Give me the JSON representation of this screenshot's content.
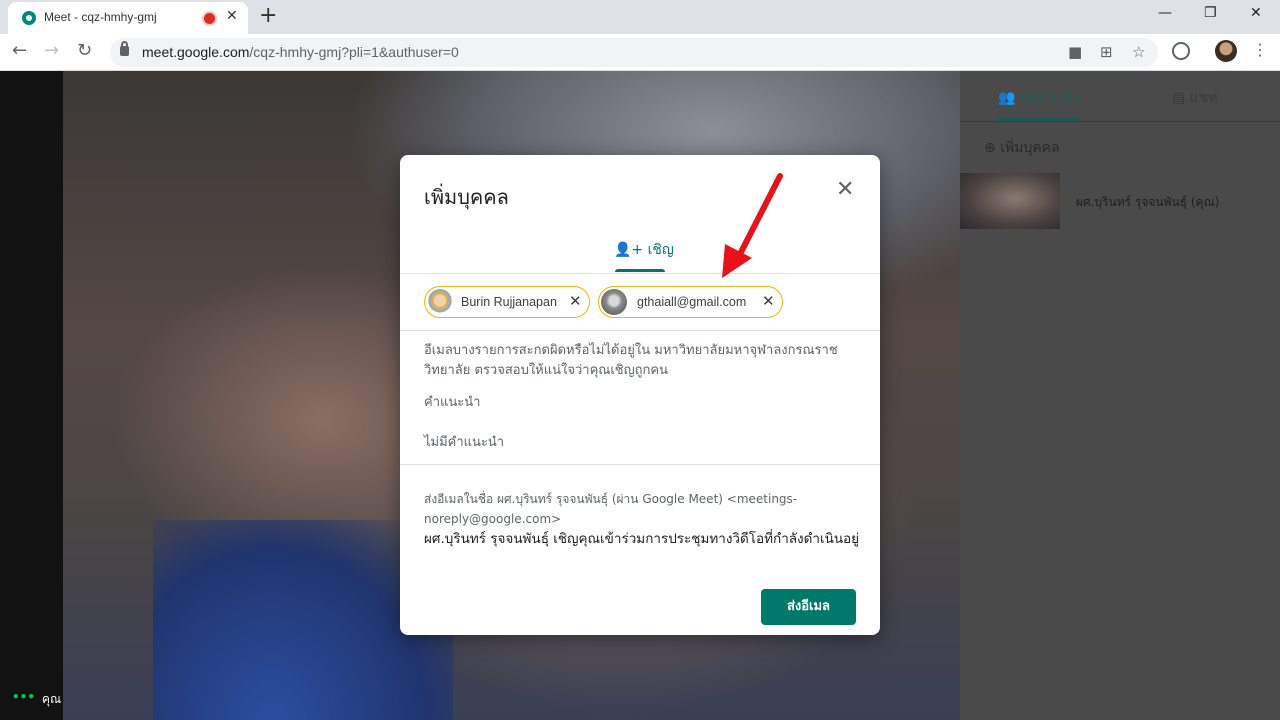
{
  "browser": {
    "tab_title": "Meet - cqz-hmhy-gmj",
    "tab_close": "✕",
    "new_tab": "+",
    "url_host": "meet.google.com",
    "url_path": "/cqz-hmhy-gmj?pli=1&authuser=0",
    "window_minimize": "—",
    "window_restore": "❐",
    "window_close": "✕"
  },
  "meeting": {
    "self_label": "คุณ",
    "self_dots": "•••"
  },
  "side_panel": {
    "tab_people": "บุคคล (1)",
    "tab_chat": "แชท",
    "add_person": "เพิ่มบุคคล",
    "participant_name": "ผศ.บุรินทร์ รุจจนพันธุ์ (คุณ)"
  },
  "dialog": {
    "title": "เพิ่มบุคคล",
    "close": "✕",
    "invite_tab": "เชิญ",
    "chips": [
      {
        "label": "Burin Rujjanapan"
      },
      {
        "label": "gthaiall@gmail.com"
      }
    ],
    "chip_remove": "✕",
    "warning": "อีเมลบางรายการสะกดผิดหรือไม่ได้อยู่ใน มหาวิทยาลัยมหาจุฬาลงกรณราชวิทยาลัย ตรวจสอบให้แน่ใจว่าคุณเชิญถูกคน",
    "suggestions_label": "คำแนะนำ",
    "no_suggestions": "ไม่มีคำแนะนำ",
    "sender": "ส่งอีเมลในชื่อ ผศ.บุรินทร์ รุจจนพันธุ์ (ผ่าน Google Meet) <meetings-noreply@google.com>",
    "message": "ผศ.บุรินทร์ รุจจนพันธุ์ เชิญคุณเข้าร่วมการประชุมทางวิดีโอที่กำลังดำเนินอยู่",
    "send_button": "ส่งอีเมล"
  },
  "colors": {
    "accent": "#00796b",
    "chip_border": "#f5b400",
    "annotation_arrow": "#e8121b"
  }
}
